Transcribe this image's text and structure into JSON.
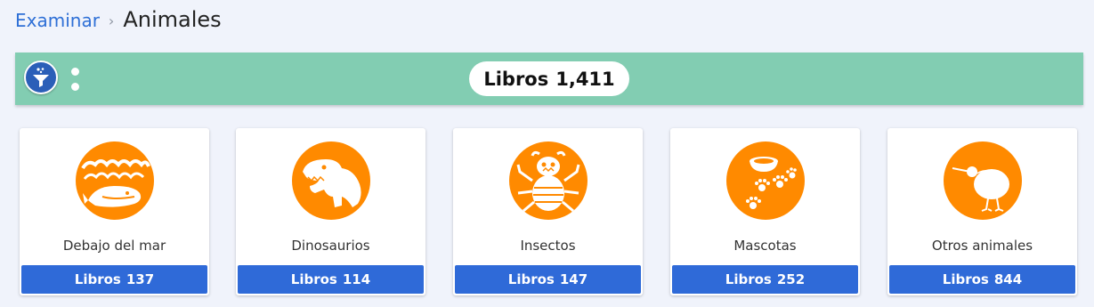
{
  "breadcrumb": {
    "parent": "Examinar",
    "separator": "›",
    "current": "Animales"
  },
  "filter_bar": {
    "filter_icon": "funnel-icon",
    "more_icon": "vertical-dots-icon",
    "count_label": "Libros",
    "count_value": "1,411"
  },
  "colors": {
    "accent_orange": "#ff8a00",
    "bar_green": "#82cdb2",
    "button_blue": "#2f6ad8",
    "link_blue": "#2e6fd6"
  },
  "categories": [
    {
      "title": "Debajo del mar",
      "books_label": "Libros",
      "books_count": "137",
      "icon": "whale-waves-icon"
    },
    {
      "title": "Dinosaurios",
      "books_label": "Libros",
      "books_count": "114",
      "icon": "dinosaur-icon"
    },
    {
      "title": "Insectos",
      "books_label": "Libros",
      "books_count": "147",
      "icon": "bug-icon"
    },
    {
      "title": "Mascotas",
      "books_label": "Libros",
      "books_count": "252",
      "icon": "pet-bowl-paws-icon"
    },
    {
      "title": "Otros animales",
      "books_label": "Libros",
      "books_count": "844",
      "icon": "kiwi-bird-icon"
    }
  ]
}
